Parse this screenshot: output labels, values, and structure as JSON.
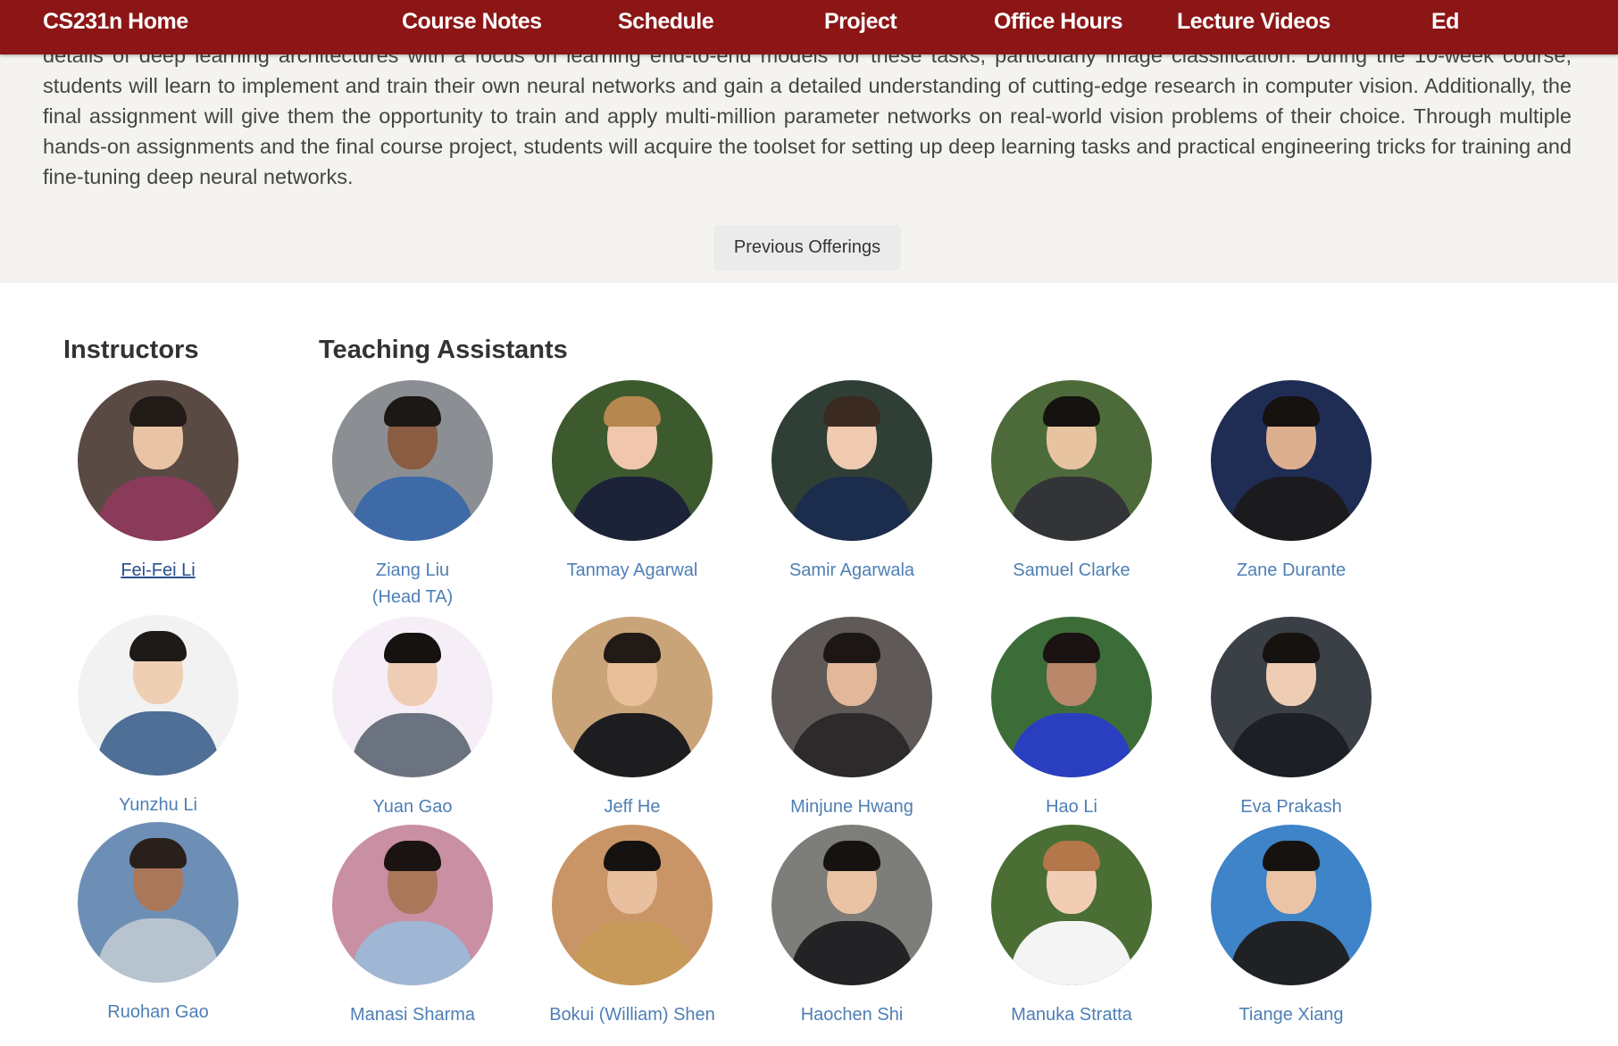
{
  "nav": {
    "brand": "CS231n Home",
    "items": [
      "Course Notes",
      "Schedule",
      "Project",
      "Office Hours",
      "Lecture Videos",
      "Ed"
    ]
  },
  "intro": {
    "text": "details of deep learning architectures with a focus on learning end-to-end models for these tasks, particularly image classification. During the 10-week course, students will learn to implement and train their own neural networks and gain a detailed understanding of cutting-edge research in computer vision. Additionally, the final assignment will give them the opportunity to train and apply multi-million parameter networks on real-world vision problems of their choice. Through multiple hands-on assignments and the final course project, students will acquire the toolset for setting up deep learning tasks and practical engineering tricks for training and fine-tuning deep neural networks.",
    "button": "Previous Offerings"
  },
  "instructors": {
    "title": "Instructors",
    "people": [
      {
        "name": "Fei-Fei Li",
        "note": ""
      },
      {
        "name": "Yunzhu Li",
        "note": ""
      },
      {
        "name": "Ruohan Gao",
        "note": ""
      }
    ]
  },
  "tas": {
    "title": "Teaching Assistants",
    "people": [
      {
        "name": "Ziang Liu",
        "note": "(Head TA)"
      },
      {
        "name": "Tanmay Agarwal",
        "note": ""
      },
      {
        "name": "Samir Agarwala",
        "note": ""
      },
      {
        "name": "Samuel Clarke",
        "note": ""
      },
      {
        "name": "Zane Durante",
        "note": ""
      },
      {
        "name": "Yuan Gao",
        "note": ""
      },
      {
        "name": "Jeff He",
        "note": ""
      },
      {
        "name": "Minjune Hwang",
        "note": ""
      },
      {
        "name": "Hao Li",
        "note": ""
      },
      {
        "name": "Eva Prakash",
        "note": ""
      },
      {
        "name": "Manasi Sharma",
        "note": ""
      },
      {
        "name": "Bokui (William) Shen",
        "note": ""
      },
      {
        "name": "Haochen Shi",
        "note": ""
      },
      {
        "name": "Manuka Stratta",
        "note": ""
      },
      {
        "name": "Tiange Xiang",
        "note": ""
      }
    ]
  },
  "colors": {
    "nav_bg": "#8c1515",
    "intro_bg": "#f4f3ef",
    "name_color": "#4e7fb5",
    "link_color": "#2a4f8e"
  }
}
